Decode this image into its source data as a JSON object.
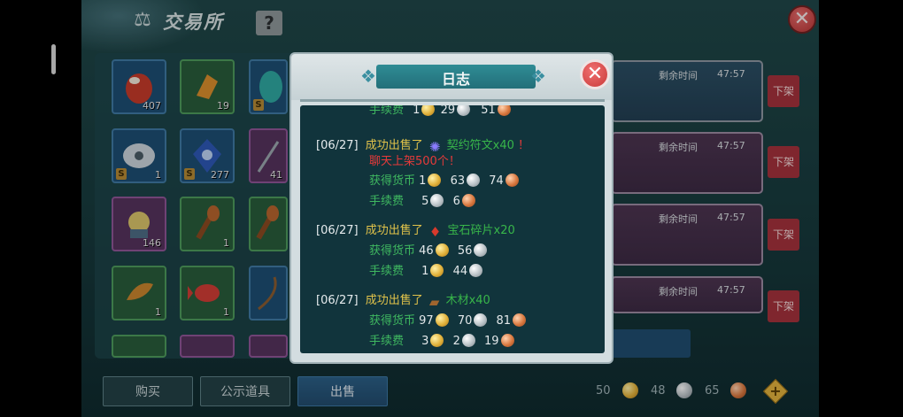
{
  "header": {
    "title": "交易所",
    "help_label": "?",
    "close_label": "✕"
  },
  "grid": {
    "items": [
      {
        "count": "407",
        "badge": ""
      },
      {
        "count": "19",
        "badge": ""
      },
      {
        "count": "",
        "badge": "S"
      },
      {
        "count": "1",
        "badge": "S"
      },
      {
        "count": "277",
        "badge": "S"
      },
      {
        "count": "41",
        "badge": ""
      },
      {
        "count": "146",
        "badge": ""
      },
      {
        "count": "1",
        "badge": ""
      },
      {
        "count": "",
        "badge": ""
      },
      {
        "count": "1",
        "badge": ""
      },
      {
        "count": "1",
        "badge": ""
      },
      {
        "count": "",
        "badge": ""
      }
    ]
  },
  "listings": [
    {
      "remain_label": "剩余时间",
      "time": "47:57",
      "action": "下架"
    },
    {
      "remain_label": "剩余时间",
      "time": "47:57",
      "action": "下架"
    },
    {
      "remain_label": "剩余时间",
      "time": "47:57",
      "action": "下架"
    },
    {
      "remain_label": "剩余时间",
      "time": "47:57",
      "action": "下架"
    }
  ],
  "bottom": {
    "tabs": [
      "购买",
      "公示道具",
      "出售"
    ],
    "currency": {
      "gold": "50",
      "silver": "48",
      "copper": "65"
    }
  },
  "modal": {
    "title": "日志",
    "close_label": "✕",
    "partial_row": {
      "label": "手续费",
      "gold": "1",
      "silver": "29",
      "copper": "51"
    },
    "entries": [
      {
        "date": "[06/27]",
        "action": "成功出售了",
        "item": "契约符文x40",
        "item_close": "！",
        "extra": "聊天上架500个！",
        "earned_label": "获得货币",
        "earned": {
          "gold": "1",
          "silver": "63",
          "copper": "74"
        },
        "fee_label": "手续费",
        "fee": {
          "silver": "5",
          "copper": "6"
        }
      },
      {
        "date": "[06/27]",
        "action": "成功出售了",
        "item": "宝石碎片x20",
        "earned_label": "获得货币",
        "earned": {
          "gold": "46",
          "silver": "56"
        },
        "fee_label": "手续费",
        "fee": {
          "gold": "1",
          "silver": "44"
        }
      },
      {
        "date": "[06/27]",
        "action": "成功出售了",
        "item": "木材x40",
        "earned_label": "获得货币",
        "earned": {
          "gold": "97",
          "silver": "70",
          "copper": "81"
        },
        "fee_label": "手续费",
        "fee": {
          "gold": "3",
          "silver": "2",
          "copper": "19"
        }
      }
    ]
  },
  "colors": {
    "accent": "#2f8c95",
    "sold": "#e0c24a",
    "item": "#38b64a",
    "warn": "#e63a3a",
    "off_button": "#a3313b"
  },
  "icons": [
    "scale-icon",
    "gold-coin-icon",
    "silver-coin-icon",
    "copper-coin-icon",
    "plus-icon"
  ]
}
